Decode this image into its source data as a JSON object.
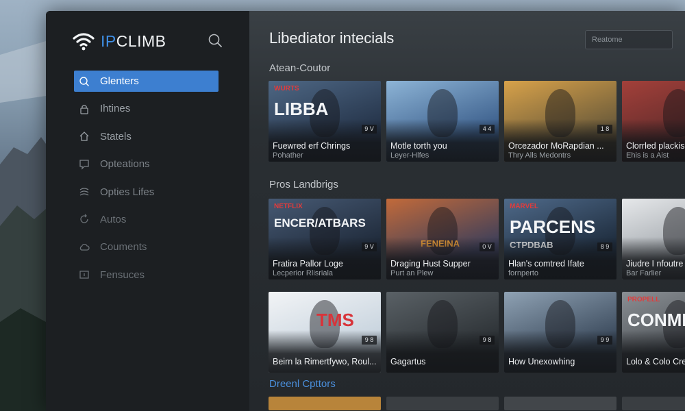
{
  "app": {
    "logo_prefix": "IP",
    "logo_suffix": "CLIMB"
  },
  "sidebar": {
    "items": [
      {
        "label": "Glenters",
        "icon": "search-icon",
        "active": true
      },
      {
        "label": "Ihtines",
        "icon": "lock-icon"
      },
      {
        "label": "Statels",
        "icon": "home-icon"
      },
      {
        "label": "Opteations",
        "icon": "speech-bubble-icon"
      },
      {
        "label": "Opties Lifes",
        "icon": "layers-icon"
      },
      {
        "label": "Autos",
        "icon": "refresh-icon"
      },
      {
        "label": "Couments",
        "icon": "cloud-icon"
      },
      {
        "label": "Fensuces",
        "icon": "monitor-icon"
      }
    ]
  },
  "main": {
    "title": "Libediator intecials",
    "search_placeholder": "Reatome",
    "sections": [
      {
        "title": "Atean-Coutor",
        "cards": [
          {
            "title": "Fuewred erf Chrings",
            "subtitle": "Pohather",
            "badge": "9 V",
            "overlay": "LIBBA",
            "overlay_small": "WURTS",
            "palette": [
              "#25344a",
              "#4e6784"
            ]
          },
          {
            "title": "Motle torth you",
            "subtitle": "Leyer-Hlfes",
            "badge": "4 4",
            "overlay": "",
            "palette": [
              "#3c5f8c",
              "#8db4d6"
            ]
          },
          {
            "title": "Orcezador MoRapdian ...",
            "subtitle": "Thry Alls Medontrs",
            "badge": "1 8",
            "overlay": "",
            "palette": [
              "#6a5a3a",
              "#d8a24a"
            ]
          },
          {
            "title": "Clorrled plackis",
            "subtitle": "Ehis is a Aist",
            "badge": "",
            "overlay": "",
            "palette": [
              "#5b2a2a",
              "#a3403a"
            ]
          }
        ]
      },
      {
        "title": "Pros Landbrigs",
        "cards": [
          {
            "title": "Fratira Pallor Loge",
            "subtitle": "Lecperior Rlisriala",
            "badge": "9 V",
            "overlay": "ENCER/ATBARS",
            "overlay_small": "NETFLIX",
            "palette": [
              "#1f2a3a",
              "#475a74"
            ]
          },
          {
            "title": "Draging Hust Supper",
            "subtitle": "Purt an Plew",
            "badge": "0 V",
            "overlay": "FENEINA",
            "palette": [
              "#3d3f5a",
              "#c26a3a"
            ]
          },
          {
            "title": "Hlan's comtred Ifate",
            "subtitle": "fornperto",
            "badge": "8 9",
            "overlay": "PARCENS",
            "overlay_small": "MARVEL",
            "overlay_left": "CTPDBAB",
            "palette": [
              "#1e2c3d",
              "#4f6a8a"
            ]
          },
          {
            "title": "Jiudre I nfoutre",
            "subtitle": "Bar Farlier",
            "badge": "",
            "overlay": "",
            "palette": [
              "#9aa0a6",
              "#e6e8ea"
            ]
          }
        ]
      },
      {
        "title": "",
        "cards": [
          {
            "title": "Beirn la Rimertfywo, Roul...",
            "subtitle": "",
            "badge": "9 8",
            "overlay": "TMS",
            "palette": [
              "#c7d3de",
              "#f2f4f6"
            ]
          },
          {
            "title": "Gagartus",
            "subtitle": "",
            "badge": "9 8",
            "overlay": "",
            "palette": [
              "#2d3236",
              "#5a6166"
            ]
          },
          {
            "title": "How Unexowhing",
            "subtitle": "",
            "badge": "9 9",
            "overlay": "",
            "palette": [
              "#3b4a5c",
              "#8fa2b4"
            ]
          },
          {
            "title": "Lolo & Colo Crea",
            "subtitle": "",
            "badge": "",
            "overlay": "CONMEIA",
            "overlay_small": "PROPELL",
            "palette": [
              "#4a4f54",
              "#8a8f94"
            ]
          }
        ]
      },
      {
        "title": "Dreenl Cpttors",
        "cards": []
      }
    ]
  }
}
